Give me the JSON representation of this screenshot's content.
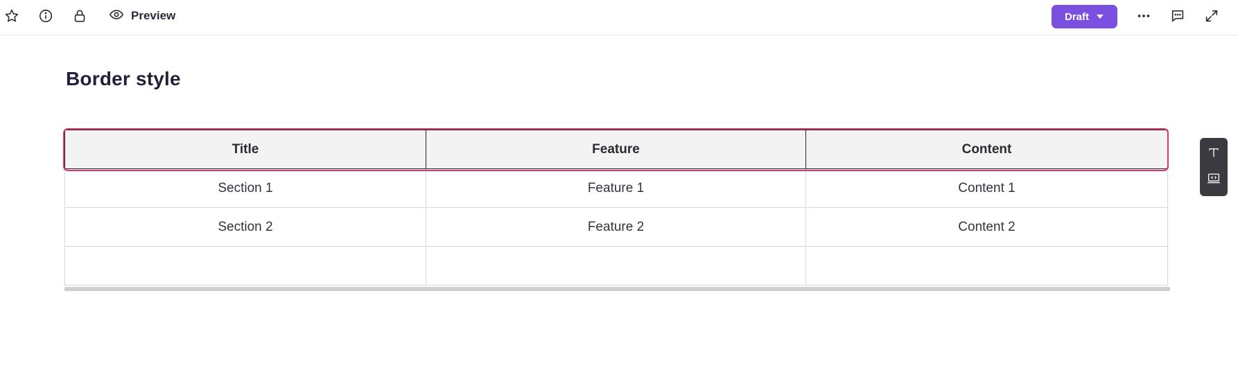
{
  "toolbar": {
    "preview_label": "Preview",
    "status_label": "Draft",
    "accent_color": "#7b4fe0",
    "icons": [
      "star-icon",
      "info-icon",
      "lock-icon",
      "eye-icon",
      "chevron-down-icon",
      "more-icon",
      "comment-icon",
      "expand-icon"
    ]
  },
  "page": {
    "title": "Border style"
  },
  "table": {
    "headers": [
      "Title",
      "Feature",
      "Content"
    ],
    "rows": [
      [
        "Section 1",
        "Feature 1",
        "Content 1"
      ],
      [
        "Section 2",
        "Feature 2",
        "Content 2"
      ],
      [
        "",
        "",
        ""
      ]
    ],
    "selection_color": "#e0316e"
  },
  "side_toolbar": {
    "icons": [
      "text-icon",
      "embed-icon"
    ]
  }
}
